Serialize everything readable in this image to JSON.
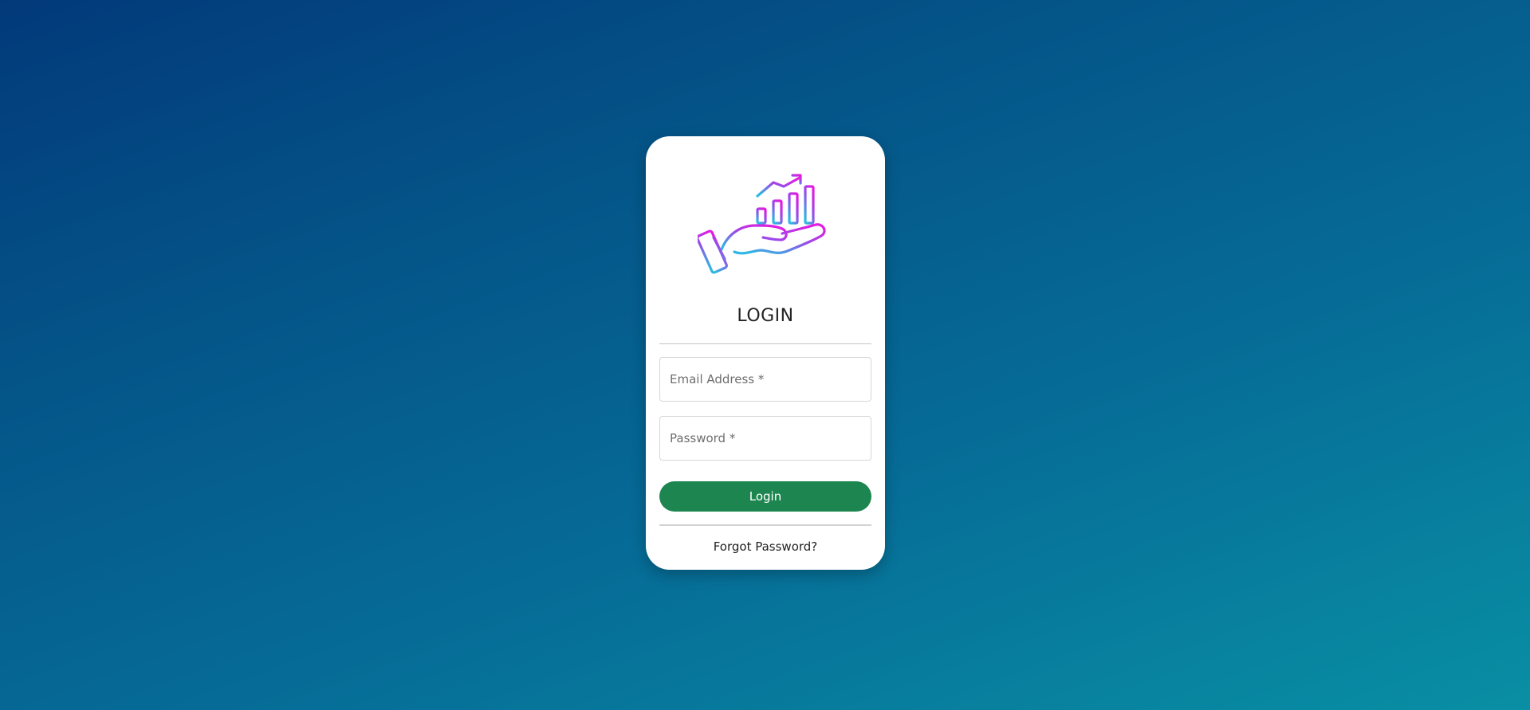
{
  "login": {
    "logo_icon": "hand-holding-growth-chart-icon",
    "title": "LOGIN",
    "email": {
      "placeholder": "Email Address *",
      "value": ""
    },
    "password": {
      "placeholder": "Password *",
      "value": ""
    },
    "submit_label": "Login",
    "forgot_label": "Forgot Password?"
  },
  "colors": {
    "background_start": "#02397a",
    "background_end": "#098fa4",
    "button": "#1d8650",
    "logo_gradient_top": "#e21ce0",
    "logo_gradient_bottom": "#2fb8e4"
  }
}
